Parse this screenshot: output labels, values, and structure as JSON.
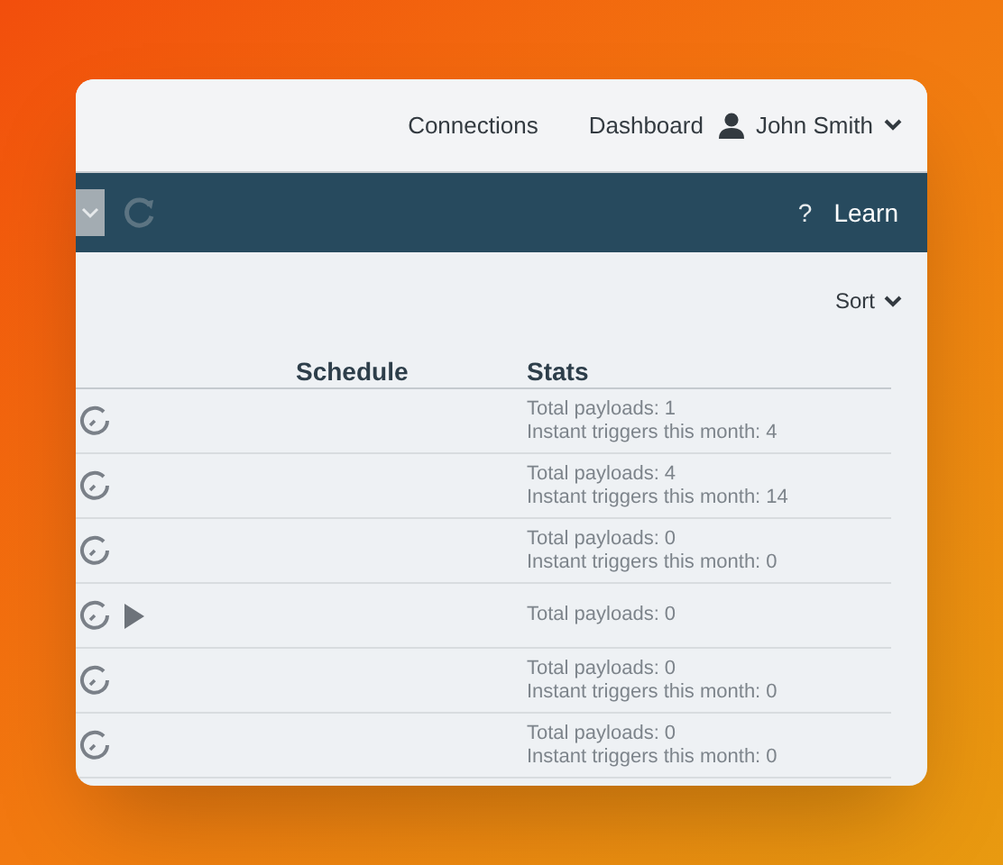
{
  "nav": {
    "links": [
      "Connections",
      "Dashboard"
    ],
    "user": "John Smith"
  },
  "toolbar": {
    "help": "?",
    "learn": "Learn"
  },
  "sort": "Sort",
  "table": {
    "columns": [
      "Schedule",
      "Stats"
    ],
    "rows": [
      {
        "play_button": false,
        "stats": [
          "Total payloads: 1",
          "Instant triggers this month: 4"
        ]
      },
      {
        "play_button": false,
        "stats": [
          "Total payloads: 4",
          "Instant triggers this month: 14"
        ]
      },
      {
        "play_button": false,
        "stats": [
          "Total payloads: 0",
          "Instant triggers this month: 0"
        ]
      },
      {
        "play_button": true,
        "stats": [
          "Total payloads: 0"
        ]
      },
      {
        "play_button": false,
        "stats": [
          "Total payloads: 0",
          "Instant triggers this month: 0"
        ]
      },
      {
        "play_button": false,
        "stats": [
          "Total payloads: 0",
          "Instant triggers this month: 0"
        ]
      }
    ]
  }
}
